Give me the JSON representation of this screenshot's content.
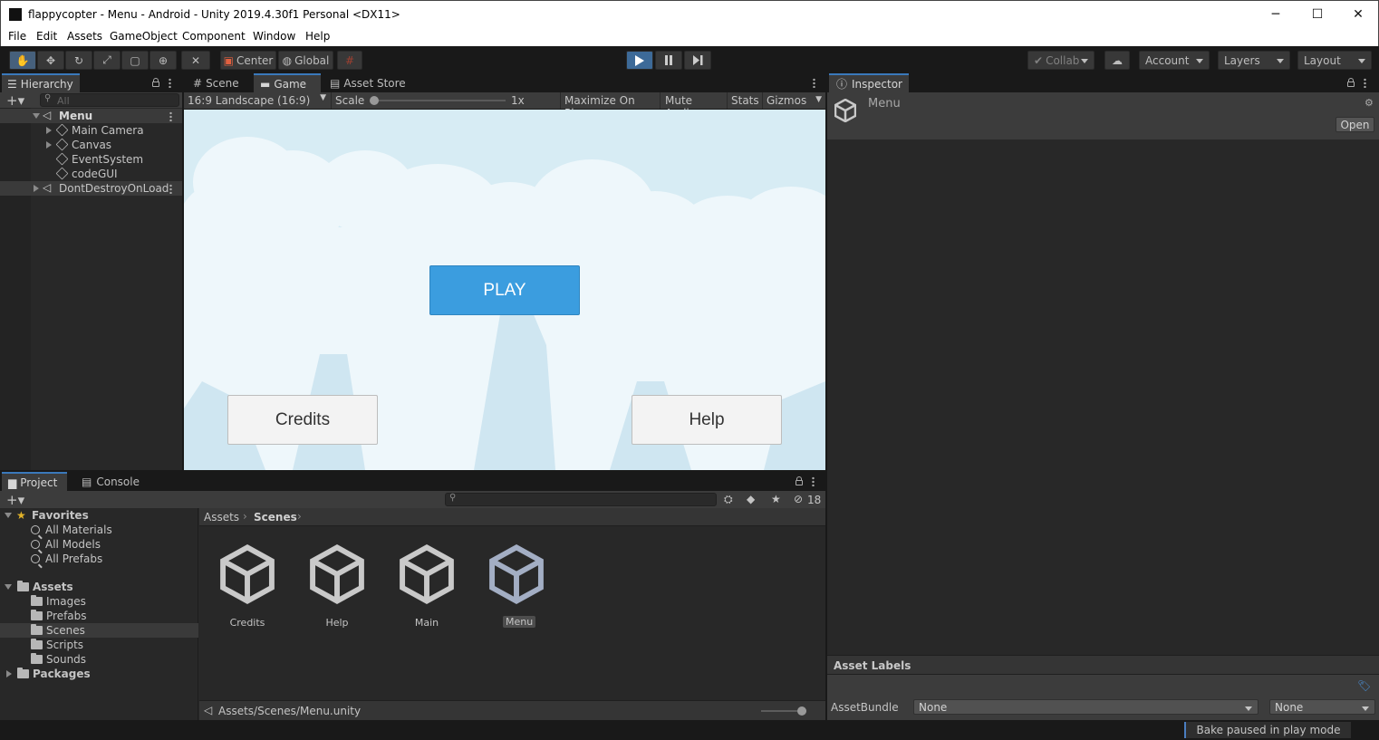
{
  "window": {
    "title": "flappycopter - Menu - Android - Unity 2019.4.30f1 Personal <DX11>",
    "minimize": "─",
    "maximize": "☐",
    "close": "✕"
  },
  "menubar": [
    "File",
    "Edit",
    "Assets",
    "GameObject",
    "Component",
    "Window",
    "Help"
  ],
  "toolbar": {
    "pivot": "Center",
    "space": "Global",
    "collab": "Collab",
    "account": "Account",
    "layers": "Layers",
    "layout": "Layout"
  },
  "hierarchy": {
    "tab": "Hierarchy",
    "search_placeholder": "All",
    "items": [
      "Menu",
      "Main Camera",
      "Canvas",
      "EventSystem",
      "codeGUI",
      "DontDestroyOnLoad"
    ]
  },
  "center_tabs": [
    "Scene",
    "Game",
    "Asset Store"
  ],
  "game": {
    "aspect": "16:9 Landscape (16:9)",
    "scale_label": "Scale",
    "scale_value": "1x",
    "maximize": "Maximize On Play",
    "mute": "Mute Audio",
    "stats": "Stats",
    "gizmos": "Gizmos",
    "play": "PLAY",
    "credits": "Credits",
    "help": "Help",
    "sky_color": "#d7ecf4",
    "cloud_color": "#eef7fb",
    "play_color": "#3b9ddf"
  },
  "inspector": {
    "tab": "Inspector",
    "object": "Menu",
    "open": "Open",
    "asset_labels": "Asset Labels",
    "assetbundle_label": "AssetBundle",
    "assetbundle_value": "None",
    "variant_value": "None"
  },
  "project": {
    "tabs": [
      "Project",
      "Console"
    ],
    "hidden_count": "18",
    "favorites_label": "Favorites",
    "favorites": [
      "All Materials",
      "All Models",
      "All Prefabs"
    ],
    "assets_label": "Assets",
    "asset_folders": [
      "Images",
      "Prefabs",
      "Scenes",
      "Scripts",
      "Sounds"
    ],
    "packages_label": "Packages",
    "breadcrumb": [
      "Assets",
      "Scenes"
    ],
    "files": [
      "Credits",
      "Help",
      "Main",
      "Menu"
    ],
    "path": "Assets/Scenes/Menu.unity"
  },
  "status": {
    "bake": "Bake paused in play mode"
  }
}
